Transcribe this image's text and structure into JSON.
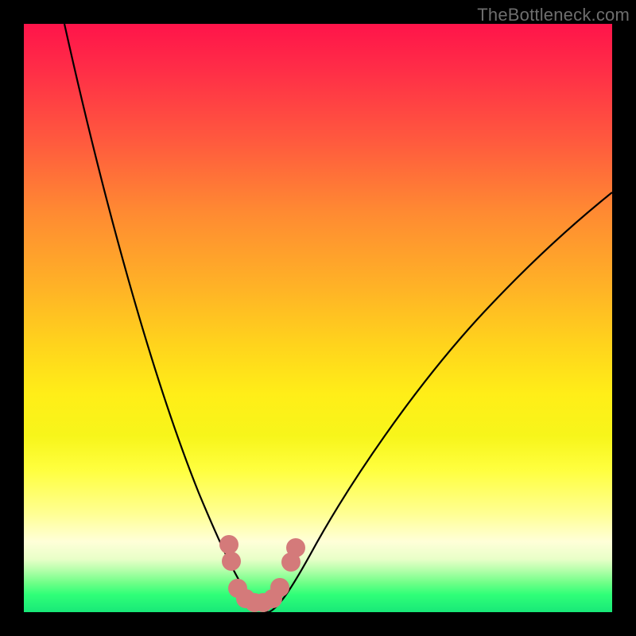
{
  "watermark": "TheBottleneck.com",
  "chart_data": {
    "type": "line",
    "title": "",
    "xlabel": "",
    "ylabel": "",
    "xlim": [
      0,
      100
    ],
    "ylim": [
      0,
      100
    ],
    "background_gradient": {
      "top": "#ff144a",
      "mid": "#ffee18",
      "bottom": "#18e878"
    },
    "series": [
      {
        "name": "left-curve",
        "x": [
          7,
          10,
          13,
          16,
          19,
          22,
          25,
          28,
          30,
          32,
          34,
          36,
          37,
          38,
          39,
          40
        ],
        "y": [
          100,
          88,
          76,
          64,
          53,
          43,
          33,
          24,
          18,
          12,
          8,
          5,
          3,
          2,
          1,
          0
        ],
        "stroke": "#000000"
      },
      {
        "name": "right-curve",
        "x": [
          40,
          42,
          44,
          47,
          50,
          55,
          60,
          65,
          70,
          75,
          80,
          85,
          90,
          95,
          100
        ],
        "y": [
          0,
          1,
          2,
          4,
          7,
          12,
          18,
          24,
          30,
          36,
          42,
          48,
          54,
          60,
          66
        ],
        "stroke": "#000000"
      }
    ],
    "markers": {
      "name": "bottom-cluster",
      "color": "#d47a7a",
      "points": [
        {
          "x": 34.5,
          "y": 11.0
        },
        {
          "x": 35.0,
          "y": 8.0
        },
        {
          "x": 36.0,
          "y": 3.6
        },
        {
          "x": 37.2,
          "y": 1.8
        },
        {
          "x": 38.5,
          "y": 1.2
        },
        {
          "x": 40.0,
          "y": 1.2
        },
        {
          "x": 41.6,
          "y": 1.8
        },
        {
          "x": 42.8,
          "y": 3.8
        },
        {
          "x": 44.8,
          "y": 8.0
        },
        {
          "x": 45.5,
          "y": 10.5
        }
      ]
    }
  }
}
